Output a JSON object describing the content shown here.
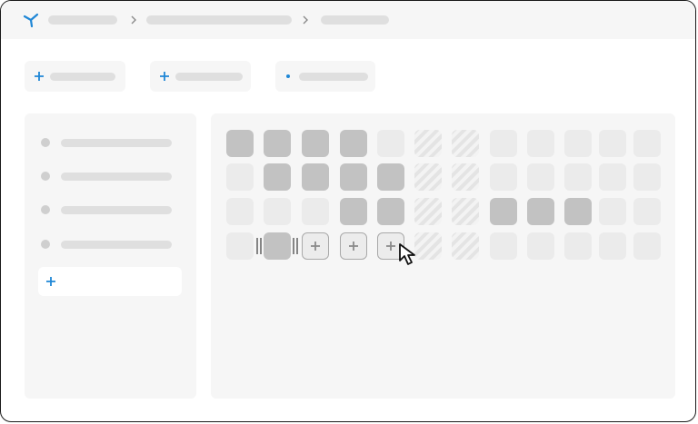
{
  "topbar": {
    "logo_icon": "branch-logo-icon",
    "breadcrumbs": [
      "",
      "",
      ""
    ]
  },
  "toolbar": {
    "buttons": [
      {
        "icon": "plus-icon",
        "label": ""
      },
      {
        "icon": "plus-icon",
        "label": ""
      },
      {
        "icon": "dot-icon",
        "label": ""
      }
    ]
  },
  "sidebar": {
    "items": [
      {
        "label": ""
      },
      {
        "label": ""
      },
      {
        "label": ""
      },
      {
        "label": ""
      }
    ],
    "add_icon": "plus-icon"
  },
  "grid": {
    "legend_states": [
      "empty",
      "filled",
      "hatched",
      "add",
      "selected"
    ],
    "rows": [
      [
        "filled",
        "filled",
        "filled",
        "filled",
        "empty",
        "hatched",
        "hatched",
        "empty",
        "empty",
        "empty",
        "empty",
        "empty"
      ],
      [
        "empty",
        "filled",
        "filled",
        "filled",
        "filled",
        "hatched",
        "hatched",
        "empty",
        "empty",
        "empty",
        "empty",
        "empty"
      ],
      [
        "empty",
        "empty",
        "empty",
        "filled",
        "filled",
        "hatched",
        "hatched",
        "filled",
        "filled",
        "filled",
        "empty",
        "empty"
      ],
      [
        "empty",
        "selected",
        "add",
        "add",
        "add",
        "hatched",
        "hatched",
        "empty",
        "empty",
        "empty",
        "empty",
        "empty"
      ]
    ]
  },
  "colors": {
    "accent": "#1f87d6",
    "filled": "#c2c2c2",
    "empty": "#ebebeb",
    "panel": "#f6f6f6"
  }
}
